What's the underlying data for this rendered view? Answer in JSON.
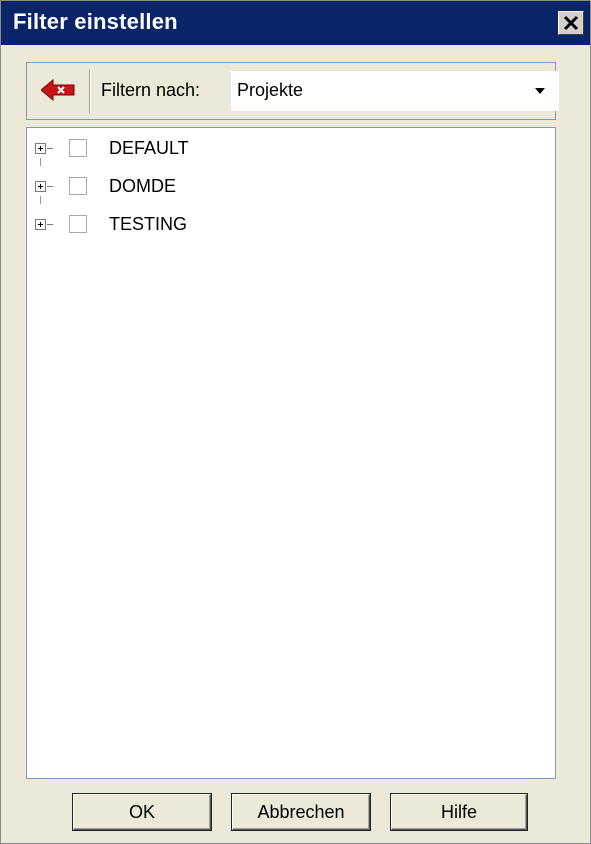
{
  "window": {
    "title": "Filter einstellen"
  },
  "toolbar": {
    "clear_icon": "clear-filter-icon",
    "filter_label": "Filtern nach:",
    "filter_value": "Projekte"
  },
  "tree": {
    "items": [
      {
        "label": "DEFAULT",
        "checked": false,
        "expanded": false
      },
      {
        "label": "DOMDE",
        "checked": false,
        "expanded": false
      },
      {
        "label": "TESTING",
        "checked": false,
        "expanded": false
      }
    ]
  },
  "buttons": {
    "ok": "OK",
    "cancel": "Abbrechen",
    "help": "Hilfe"
  },
  "colors": {
    "titlebar": "#0a246a",
    "window_bg": "#ece9d8",
    "clear_icon": "#d01818"
  }
}
